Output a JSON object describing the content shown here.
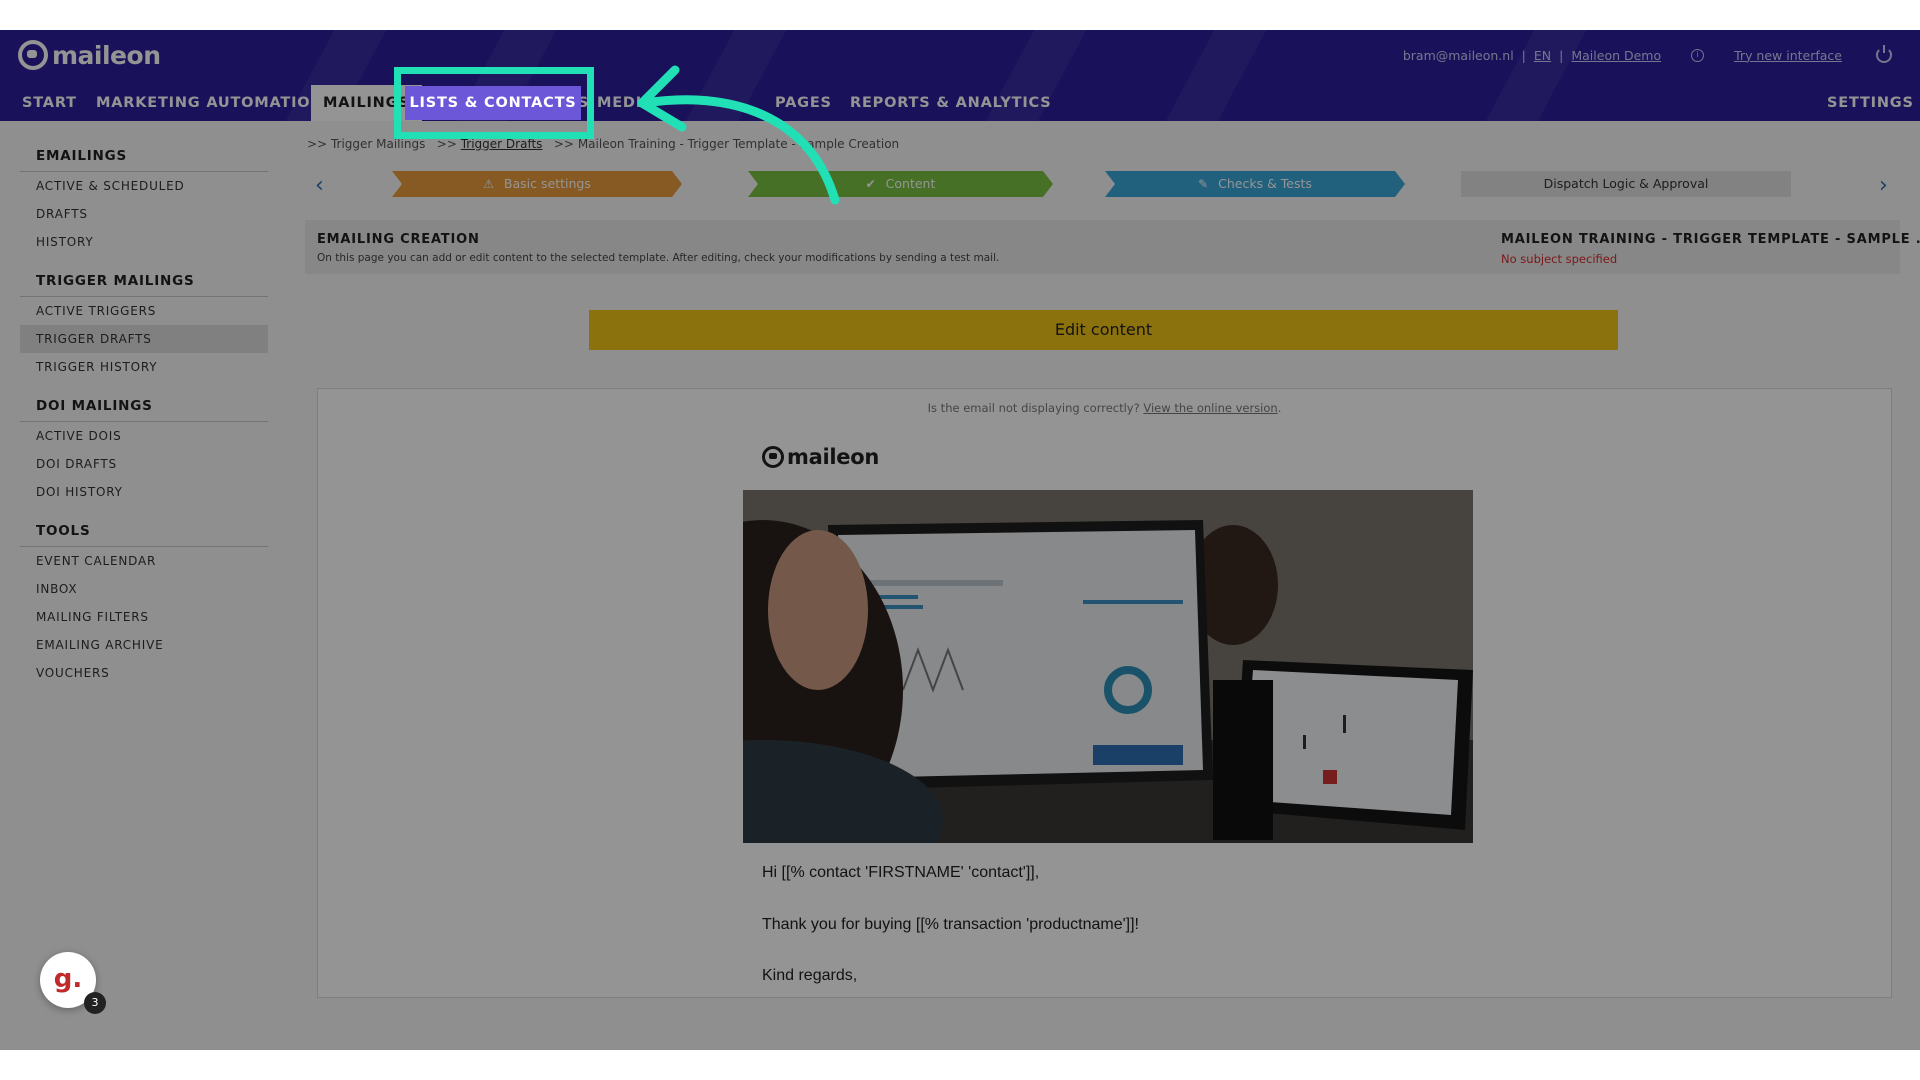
{
  "brand": {
    "name": "maileon"
  },
  "account": {
    "email": "bram@maileon.nl",
    "language": "EN",
    "workspace": "Maileon Demo",
    "new_interface": "Try new interface"
  },
  "nav": {
    "start": "START",
    "marketing_automation": "MARKETING AUTOMATION",
    "mailings": "MAILINGS",
    "lists_contacts": "LISTS & CONTACTS",
    "media": "MEDIA",
    "pages": "PAGES",
    "reports": "REPORTS & ANALYTICS",
    "settings": "SETTINGS"
  },
  "sidebar": {
    "emailings": {
      "title": "EMAILINGS",
      "items": [
        "ACTIVE & SCHEDULED",
        "DRAFTS",
        "HISTORY"
      ]
    },
    "trigger_mailings": {
      "title": "TRIGGER MAILINGS",
      "items": [
        "ACTIVE TRIGGERS",
        "TRIGGER DRAFTS",
        "TRIGGER HISTORY"
      ]
    },
    "doi_mailings": {
      "title": "DOI MAILINGS",
      "items": [
        "ACTIVE DOIS",
        "DOI DRAFTS",
        "DOI HISTORY"
      ]
    },
    "tools": {
      "title": "TOOLS",
      "items": [
        "EVENT CALENDAR",
        "INBOX",
        "MAILING FILTERS",
        "EMAILING ARCHIVE",
        "VOUCHERS"
      ]
    }
  },
  "breadcrumb": {
    "sep": ">>",
    "item1": "Trigger Mailings",
    "item2": "Trigger Drafts",
    "item3": "Maileon Training - Trigger Template - Sample Creation"
  },
  "steps": [
    {
      "label": "Basic settings",
      "color": "#e79b3c",
      "icon": "warning-icon"
    },
    {
      "label": "Content",
      "color": "#7bc144",
      "icon": "check-icon"
    },
    {
      "label": "Checks & Tests",
      "color": "#3aa7d8",
      "icon": "pencil-icon"
    },
    {
      "label": "Dispatch Logic & Approval",
      "color": "#e0e0e0",
      "icon": ""
    }
  ],
  "info": {
    "title": "EMAILING CREATION",
    "desc": "On this page you can add or edit content to the selected template. After editing, check your modifications by sending a test mail.",
    "mailing_name": "MAILEON TRAINING - TRIGGER TEMPLATE - SAMPLE ...",
    "subject_status": "No subject specified"
  },
  "edit_button": "Edit content",
  "preview": {
    "notice": "Is the email not displaying correctly?",
    "notice_link": "View the online version",
    "notice_end": ".",
    "greeting": "Hi [[% contact 'FIRSTNAME' 'contact']],",
    "thanks": "Thank you for buying [[% transaction 'productname']]!",
    "signoff": "Kind regards,"
  },
  "helper_badge": {
    "letter": "g.",
    "count": "3"
  },
  "colors": {
    "header": "#2c1f9e",
    "highlight": "#22e0b6",
    "tab_highlight": "#6c57d9",
    "button": "#f0c518"
  }
}
